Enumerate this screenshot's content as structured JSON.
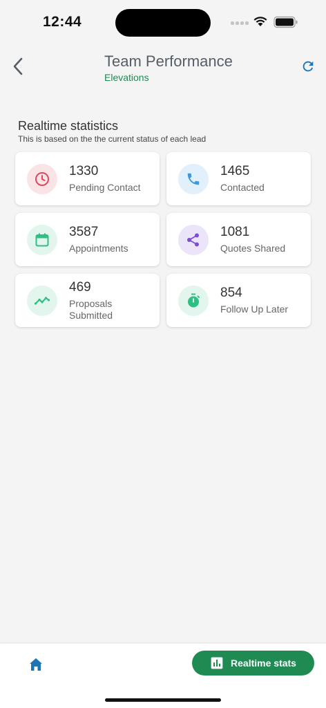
{
  "status_bar": {
    "time": "12:44"
  },
  "header": {
    "title": "Team Performance",
    "subtitle": "Elevations"
  },
  "section": {
    "title": "Realtime statistics",
    "description": "This is based on the the current status of each lead"
  },
  "stats": [
    {
      "value": "1330",
      "label": "Pending Contact",
      "icon": "clock-icon",
      "color": "#e0475a",
      "bg": "#fbe4e6"
    },
    {
      "value": "1465",
      "label": "Contacted",
      "icon": "phone-icon",
      "color": "#3d9ad9",
      "bg": "#e1f0fa"
    },
    {
      "value": "3587",
      "label": "Appointments",
      "icon": "calendar-icon",
      "color": "#2dbf83",
      "bg": "#e2f6ed"
    },
    {
      "value": "1081",
      "label": "Quotes Shared",
      "icon": "share-icon",
      "color": "#7a4fd0",
      "bg": "#ece4f8"
    },
    {
      "value": "469",
      "label": "Proposals Submitted",
      "icon": "trend-icon",
      "color": "#2dbf83",
      "bg": "#e2f6ed"
    },
    {
      "value": "854",
      "label": "Follow Up Later",
      "icon": "timer-icon",
      "color": "#2dbf83",
      "bg": "#e2f6ed"
    }
  ],
  "bottom_nav": {
    "stats_label": "Realtime stats"
  },
  "colors": {
    "accent": "#1f8a52",
    "icon_blue": "#1b75b8"
  }
}
